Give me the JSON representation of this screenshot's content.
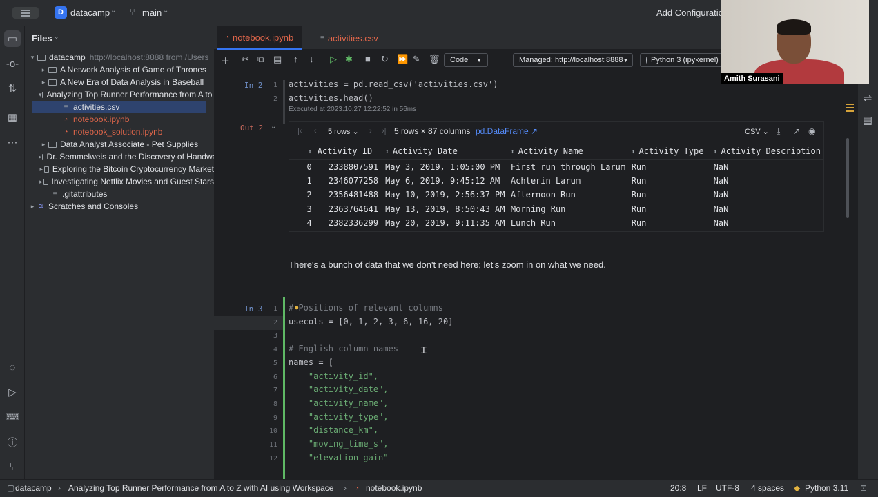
{
  "titlebar": {
    "project_badge": "D",
    "project_name": "datacamp",
    "branch": "main",
    "add_config": "Add Configuration..."
  },
  "files": {
    "title": "Files",
    "tree": [
      {
        "label": "datacamp",
        "hint": "http://localhost:8888 from /Users",
        "type": "folder",
        "expanded": true,
        "depth": 0
      },
      {
        "label": "A Network Analysis of Game of Thrones",
        "type": "folder",
        "depth": 1
      },
      {
        "label": "A New Era of Data Analysis in Baseball",
        "type": "folder",
        "depth": 1
      },
      {
        "label": "Analyzing Top Runner Performance from A to Z",
        "type": "folder",
        "expanded": true,
        "depth": 1
      },
      {
        "label": "activities.csv",
        "type": "csv",
        "depth": 2,
        "selected": true
      },
      {
        "label": "notebook.ipynb",
        "type": "notebook",
        "depth": 2
      },
      {
        "label": "notebook_solution.ipynb",
        "type": "notebook",
        "depth": 2
      },
      {
        "label": "Data Analyst Associate - Pet Supplies",
        "type": "folder",
        "depth": 1
      },
      {
        "label": "Dr. Semmelweis and the Discovery of Handwashing",
        "type": "folder",
        "depth": 1
      },
      {
        "label": "Exploring the Bitcoin Cryptocurrency Market",
        "type": "folder",
        "depth": 1
      },
      {
        "label": "Investigating Netflix Movies and Guest Stars",
        "type": "folder",
        "depth": 1
      },
      {
        "label": ".gitattributes",
        "type": "file",
        "depth": 1
      },
      {
        "label": "Scratches and Consoles",
        "type": "scratch",
        "depth": 0
      }
    ]
  },
  "tabs": [
    {
      "label": "notebook.ipynb",
      "active": true
    },
    {
      "label": "activities.csv",
      "active": false
    }
  ],
  "toolbar": {
    "cell_type": "Code",
    "server": "Managed: http://localhost:8888",
    "kernel": "Python 3 (ipykernel)"
  },
  "cell2": {
    "prompt": "In 2",
    "lines": [
      {
        "n": "1",
        "text": "activities = pd.read_csv('activities.csv')"
      },
      {
        "n": "2",
        "text": "activities.head()"
      }
    ],
    "exec_note": "Executed at 2023.10.27 12:22:52 in 56ms",
    "out_prompt": "Out 2"
  },
  "dataframe": {
    "rows_select": "5 rows",
    "info": "5 rows × 87 columns",
    "type_link": "pd.DataFrame ↗",
    "export": "CSV",
    "columns": [
      "",
      "Activity ID",
      "Activity Date",
      "Activity Name",
      "Activity Type",
      "Activity Description"
    ],
    "rows": [
      [
        "0",
        "2338807591",
        "May 3, 2019, 1:05:00 PM",
        "First run through Larum",
        "Run",
        "NaN"
      ],
      [
        "1",
        "2346077258",
        "May 6, 2019, 9:45:12 AM",
        "Achterin Larum",
        "Run",
        "NaN"
      ],
      [
        "2",
        "2356481488",
        "May 10, 2019, 2:56:37 PM",
        "Afternoon Run",
        "Run",
        "NaN"
      ],
      [
        "3",
        "2363764641",
        "May 13, 2019, 8:50:43 AM",
        "Morning Run",
        "Run",
        "NaN"
      ],
      [
        "4",
        "2382336299",
        "May 20, 2019, 9:11:35 AM",
        "Lunch Run",
        "Run",
        "NaN"
      ]
    ]
  },
  "markdown": "There's a bunch of data that we don't need here; let's zoom in on what we need.",
  "cell3": {
    "prompt": "In 3",
    "lines": [
      {
        "n": "1",
        "text": "# Positions of relevant columns",
        "kind": "comment"
      },
      {
        "n": "2",
        "text": "usecols = [0, 1, 2, 3, 6, 16, 20]",
        "kind": "code"
      },
      {
        "n": "3",
        "text": "",
        "kind": "code"
      },
      {
        "n": "4",
        "text": "# English column names",
        "kind": "comment"
      },
      {
        "n": "5",
        "text": "names = [",
        "kind": "code"
      },
      {
        "n": "6",
        "text": "    \"activity_id\",",
        "kind": "string"
      },
      {
        "n": "7",
        "text": "    \"activity_date\",",
        "kind": "string"
      },
      {
        "n": "8",
        "text": "    \"activity_name\",",
        "kind": "string"
      },
      {
        "n": "9",
        "text": "    \"activity_type\",",
        "kind": "string"
      },
      {
        "n": "10",
        "text": "    \"distance_km\",",
        "kind": "string"
      },
      {
        "n": "11",
        "text": "    \"moving_time_s\",",
        "kind": "string"
      },
      {
        "n": "12",
        "text": "    \"elevation_gain\"",
        "kind": "string"
      }
    ]
  },
  "statusbar": {
    "breadcrumbs": [
      "datacamp",
      "Analyzing Top Runner Performance from A to Z with AI using Workspace",
      "notebook.ipynb"
    ],
    "position": "20:8",
    "line_sep": "LF",
    "encoding": "UTF-8",
    "indent": "4 spaces",
    "interpreter": "Python 3.11"
  },
  "webcam": {
    "name": "Amith Surasani"
  },
  "colors": {
    "accent": "#3574f0",
    "selection": "#2e436e",
    "run_marker": "#5fb865"
  }
}
